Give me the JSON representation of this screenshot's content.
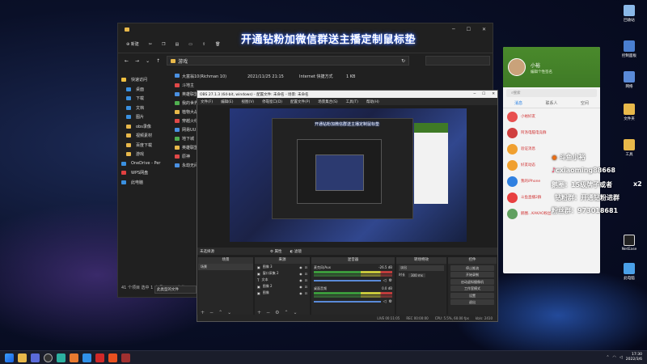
{
  "overlay": {
    "banner": "开通钻粉加微信群送主播定制鼠标垫"
  },
  "explorer": {
    "new_label": "新建",
    "address": "游戏",
    "nav": [
      "快速访问",
      "桌面",
      "下载",
      "文档",
      "图片",
      "obs录像",
      "视频素材",
      "百度下载",
      "游戏",
      "OneDrive - Per",
      "WPS网盘",
      "此电脑"
    ],
    "first_row": {
      "name": "大富翁10(Richman 10)",
      "date": "2021/11/25 21:15",
      "type": "Internet 快捷方式",
      "size": "1 KB"
    },
    "rows": [
      "斗地主",
      "英雄联盟",
      "我的世界",
      "植物大战",
      "穿越火线",
      "网易UU",
      "地下城",
      "英雄联盟",
      "原神",
      "永劫无间"
    ],
    "status": "41 个项目  选中 1 个项目  701 字节",
    "popup": "此类型的文件"
  },
  "obs": {
    "title": "OBS 27.1.3 (64-bit, windows) - 配置文件: 未命名 - 场景: 未命名",
    "menu": [
      "文件(F)",
      "编辑(E)",
      "视图(V)",
      "停靠窗口(D)",
      "配置文件(P)",
      "场景集合(S)",
      "工具(T)",
      "帮助(H)"
    ],
    "scene_label": "未选择源",
    "btn_properties": "属性",
    "btn_filters": "滤镜",
    "docks": {
      "scenes": "场景",
      "sources": "来源",
      "mixer": "混音器",
      "transitions": "转场特效",
      "controls": "控件"
    },
    "scene_item": "场景",
    "sources": [
      "图像 3",
      "窗口采集 2",
      "文本",
      "图像 2",
      "图像"
    ],
    "mixer": [
      {
        "name": "麦克风/Aux",
        "db": "-26.5 dB"
      },
      {
        "name": "桌面音频",
        "db": "0.0 dB"
      }
    ],
    "transition": {
      "type": "淡出",
      "duration_label": "时长",
      "duration": "300 ms"
    },
    "controls": [
      "停止推流",
      "开始录制",
      "启动虚拟摄像机",
      "工作室模式",
      "设置",
      "退出"
    ],
    "status": [
      "LIVE 00:11:05",
      "REC 00:00:00",
      "CPU: 5.5%, 60.00 fps",
      "kb/s: 2410"
    ]
  },
  "qq": {
    "name": "小裕",
    "sig": "编辑个性签名",
    "search": "搜索",
    "tabs": [
      "消息",
      "联系人",
      "空间"
    ],
    "items": [
      "小裕好友",
      "阿洛电脑电竞群",
      "验证消息",
      "好友动态",
      "我的iPhone",
      "斗鱼直播2群",
      "鹅圈...KAKAO粉丝"
    ]
  },
  "stream_overlay": {
    "douyu": "斗鱼小裕",
    "tiktok": "cxiaoming88668",
    "qq_group": "鹅圈：15级牌子或者",
    "x2": "x2",
    "diamond": "钻粉群：开通钻粉进群",
    "fans": "粉丝群：973018681"
  },
  "desktop": {
    "icons_right": [
      "回收站",
      "控制面板",
      "网络",
      "工具",
      "文件夹",
      "此电脑"
    ],
    "netease": "NetEase"
  },
  "taskbar": {
    "time": "17:30",
    "date": "2022/3/6"
  }
}
